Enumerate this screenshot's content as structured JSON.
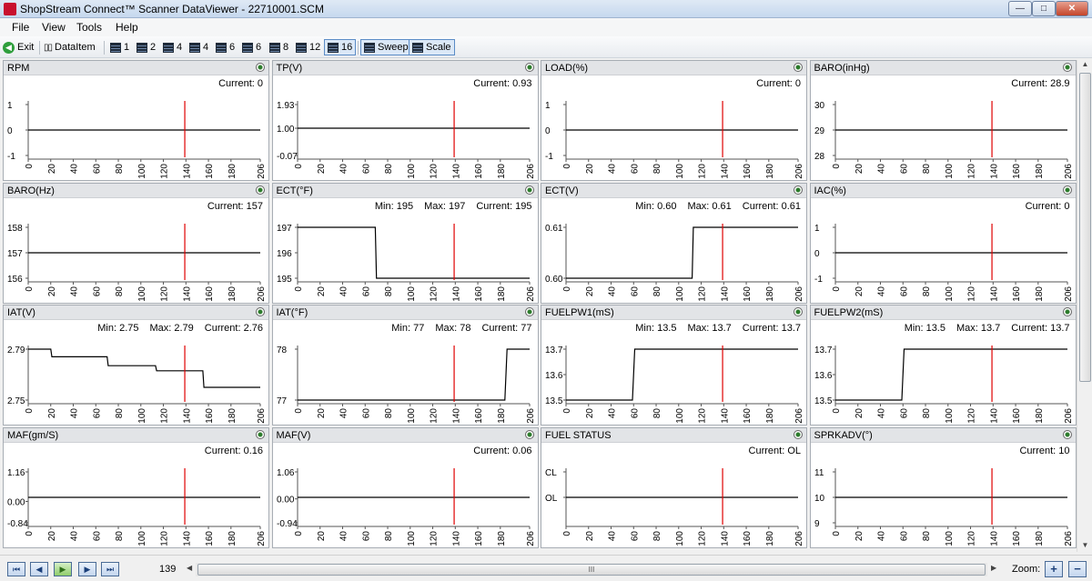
{
  "window": {
    "title": "ShopStream Connect™ Scanner DataViewer - 22710001.SCM",
    "min": "—",
    "max": "□",
    "close": "✕"
  },
  "menu": [
    "File",
    "View",
    "Tools",
    "Help"
  ],
  "toolbar": {
    "exit": "Exit",
    "dataitem": "DataItem",
    "layouts": [
      "1",
      "2",
      "4",
      "4",
      "6",
      "6",
      "8",
      "12",
      "16"
    ],
    "active_layout": "16",
    "sweep": "Sweep",
    "scale": "Scale"
  },
  "colors": {
    "trace": "#000000",
    "cursor": "#e00000"
  },
  "x_ticks": [
    "0",
    "20",
    "40",
    "60",
    "80",
    "100",
    "120",
    "140",
    "160",
    "180",
    "206"
  ],
  "cursor_x": 139,
  "panels": [
    {
      "name": "RPM",
      "current_label": "Current: 0",
      "y_labels": [
        "1",
        "0",
        "-1"
      ],
      "y_values": [
        1,
        0,
        -1
      ],
      "ylim": [
        -1,
        1
      ],
      "series": [
        [
          0,
          0
        ],
        [
          206,
          0
        ]
      ]
    },
    {
      "name": "TP(V)",
      "current_label": "Current: 0.93",
      "y_labels": [
        "1.93",
        "1.00",
        "-0.07"
      ],
      "y_values": [
        1.93,
        1.0,
        -0.07
      ],
      "ylim": [
        -0.07,
        1.93
      ],
      "series": [
        [
          0,
          1.0
        ],
        [
          206,
          1.0
        ]
      ]
    },
    {
      "name": "LOAD(%)",
      "current_label": "Current: 0",
      "y_labels": [
        "1",
        "0",
        "-1"
      ],
      "y_values": [
        1,
        0,
        -1
      ],
      "ylim": [
        -1,
        1
      ],
      "series": [
        [
          0,
          0
        ],
        [
          206,
          0
        ]
      ]
    },
    {
      "name": "BARO(inHg)",
      "current_label": "Current: 28.9",
      "y_labels": [
        "30",
        "29",
        "28"
      ],
      "y_values": [
        30,
        29,
        28
      ],
      "ylim": [
        28,
        30
      ],
      "series": [
        [
          0,
          29
        ],
        [
          206,
          29
        ]
      ]
    },
    {
      "name": "BARO(Hz)",
      "current_label": "Current: 157",
      "y_labels": [
        "158",
        "157",
        "156"
      ],
      "y_values": [
        158,
        157,
        156
      ],
      "ylim": [
        156,
        158
      ],
      "series": [
        [
          0,
          157
        ],
        [
          206,
          157
        ]
      ]
    },
    {
      "name": "ECT(°F)",
      "min_label": "Min: 195",
      "max_label": "Max: 197",
      "current_label": "Current: 195",
      "y_labels": [
        "197",
        "196",
        "195"
      ],
      "y_values": [
        197,
        196,
        195
      ],
      "ylim": [
        195,
        197
      ],
      "series": [
        [
          0,
          197
        ],
        [
          69,
          197
        ],
        [
          70,
          195
        ],
        [
          206,
          195
        ]
      ]
    },
    {
      "name": "ECT(V)",
      "min_label": "Min: 0.60",
      "max_label": "Max: 0.61",
      "current_label": "Current: 0.61",
      "y_labels": [
        "0.61",
        "0.60"
      ],
      "y_values": [
        0.61,
        0.6
      ],
      "ylim": [
        0.6,
        0.61
      ],
      "series": [
        [
          0,
          0.6
        ],
        [
          112,
          0.6
        ],
        [
          113,
          0.61
        ],
        [
          206,
          0.61
        ]
      ]
    },
    {
      "name": "IAC(%)",
      "current_label": "Current: 0",
      "y_labels": [
        "1",
        "0",
        "-1"
      ],
      "y_values": [
        1,
        0,
        -1
      ],
      "ylim": [
        -1,
        1
      ],
      "series": [
        [
          0,
          0
        ],
        [
          206,
          0
        ]
      ]
    },
    {
      "name": "IAT(V)",
      "min_label": "Min: 2.75",
      "max_label": "Max: 2.79",
      "current_label": "Current: 2.76",
      "y_labels": [
        "2.79",
        "2.75"
      ],
      "y_values": [
        2.79,
        2.75
      ],
      "ylim": [
        2.75,
        2.79
      ],
      "series": [
        [
          0,
          2.79
        ],
        [
          20,
          2.79
        ],
        [
          21,
          2.784
        ],
        [
          70,
          2.784
        ],
        [
          71,
          2.777
        ],
        [
          113,
          2.777
        ],
        [
          114,
          2.773
        ],
        [
          155,
          2.773
        ],
        [
          156,
          2.76
        ],
        [
          206,
          2.76
        ]
      ]
    },
    {
      "name": "IAT(°F)",
      "min_label": "Min: 77",
      "max_label": "Max: 78",
      "current_label": "Current: 77",
      "y_labels": [
        "78",
        "77"
      ],
      "y_values": [
        78,
        77
      ],
      "ylim": [
        77,
        78
      ],
      "series": [
        [
          0,
          77
        ],
        [
          184,
          77
        ],
        [
          186,
          78
        ],
        [
          206,
          78
        ]
      ]
    },
    {
      "name": "FUELPW1(mS)",
      "min_label": "Min: 13.5",
      "max_label": "Max: 13.7",
      "current_label": "Current: 13.7",
      "y_labels": [
        "13.7",
        "13.6",
        "13.5"
      ],
      "y_values": [
        13.7,
        13.6,
        13.5
      ],
      "ylim": [
        13.5,
        13.7
      ],
      "series": [
        [
          0,
          13.5
        ],
        [
          59,
          13.5
        ],
        [
          61,
          13.7
        ],
        [
          206,
          13.7
        ]
      ]
    },
    {
      "name": "FUELPW2(mS)",
      "min_label": "Min: 13.5",
      "max_label": "Max: 13.7",
      "current_label": "Current: 13.7",
      "y_labels": [
        "13.7",
        "13.6",
        "13.5"
      ],
      "y_values": [
        13.7,
        13.6,
        13.5
      ],
      "ylim": [
        13.5,
        13.7
      ],
      "series": [
        [
          0,
          13.5
        ],
        [
          59,
          13.5
        ],
        [
          61,
          13.7
        ],
        [
          206,
          13.7
        ]
      ]
    },
    {
      "name": "MAF(gm/S)",
      "current_label": "Current: 0.16",
      "y_labels": [
        "1.16",
        "0.00",
        "-0.84"
      ],
      "y_values": [
        1.16,
        0.0,
        -0.84
      ],
      "ylim": [
        -0.84,
        1.16
      ],
      "series": [
        [
          0,
          0.16
        ],
        [
          206,
          0.16
        ]
      ]
    },
    {
      "name": "MAF(V)",
      "current_label": "Current: 0.06",
      "y_labels": [
        "1.06",
        "0.00",
        "-0.94"
      ],
      "y_values": [
        1.06,
        0.0,
        -0.94
      ],
      "ylim": [
        -0.94,
        1.06
      ],
      "series": [
        [
          0,
          0.06
        ],
        [
          206,
          0.06
        ]
      ]
    },
    {
      "name": "FUEL STATUS",
      "current_label": "Current: OL",
      "y_labels": [
        "CL",
        "OL"
      ],
      "y_values": [
        2,
        1
      ],
      "ylim": [
        0,
        2
      ],
      "series": [
        [
          0,
          1
        ],
        [
          206,
          1
        ]
      ]
    },
    {
      "name": "SPRKADV(°)",
      "current_label": "Current: 10",
      "y_labels": [
        "11",
        "10",
        "9"
      ],
      "y_values": [
        11,
        10,
        9
      ],
      "ylim": [
        9,
        11
      ],
      "series": [
        [
          0,
          10
        ],
        [
          206,
          10
        ]
      ]
    }
  ],
  "status": {
    "first": "⏮",
    "prev": "◀",
    "play": "▶",
    "next": "▶",
    "last": "⏭",
    "position": "139",
    "scroll_grip": "III",
    "zoom_label": "Zoom:",
    "zoom_in": "+",
    "zoom_out": "−"
  }
}
